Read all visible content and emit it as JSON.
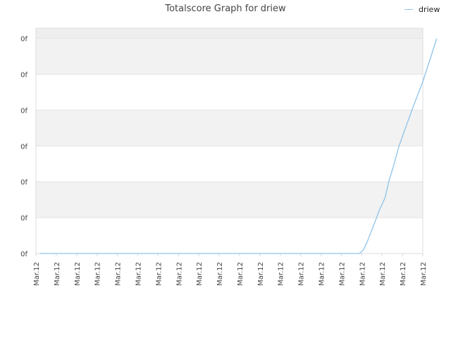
{
  "chart_data": {
    "type": "line",
    "title": "Totalscore Graph for driew",
    "xlabel": "",
    "ylabel": "",
    "y_tick_labels": [
      "0f",
      "0f",
      "0f",
      "0f",
      "0f",
      "0f",
      "0f"
    ],
    "x_tick_labels": [
      "Mar.12",
      "Mar.12",
      "Mar.12",
      "Mar.12",
      "Mar.12",
      "Mar.12",
      "Mar.12",
      "Mar.12",
      "Mar.12",
      "Mar.12",
      "Mar.12",
      "Mar.12",
      "Mar.12",
      "Mar.12",
      "Mar.12",
      "Mar.12",
      "Mar.12",
      "Mar.12",
      "Mar.12",
      "Mar.12"
    ],
    "grid": true,
    "legend_position": "top-right",
    "colors": {
      "line": "#8ec3ea",
      "band": "#f2f2f2",
      "grid": "#e3e3e3",
      "axis": "#dddddd"
    },
    "series": [
      {
        "name": "driew",
        "x": [
          0.2,
          16.3,
          16.5,
          16.7,
          17.1,
          17.3,
          17.6,
          17.8,
          18.0,
          18.3,
          19.0,
          19.5,
          20.2
        ],
        "y": [
          0,
          0,
          0.15,
          0.55,
          1.5,
          2.0,
          2.6,
          3.4,
          4.0,
          5.0,
          6.8,
          8.0,
          10.0
        ]
      }
    ],
    "xlim": [
      0,
      19.5
    ],
    "ylim": [
      0,
      10.5
    ]
  }
}
